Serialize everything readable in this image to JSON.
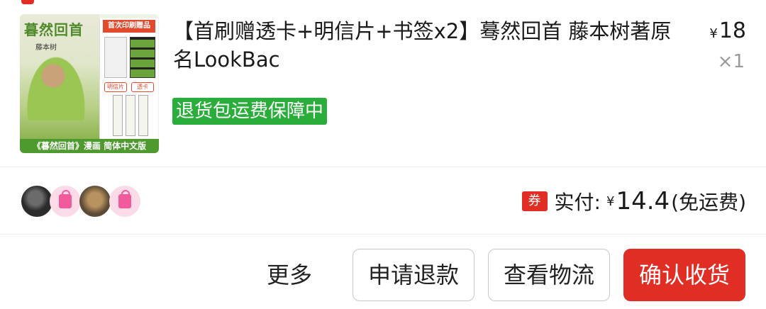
{
  "product": {
    "thumbnail": {
      "cover_title": "暮然回首",
      "cover_author": "藤本树",
      "gift_header": "首次印刷赠品",
      "gift_label_1": "明信片",
      "gift_label_2": "透卡",
      "bottom_caption": "《暮然回首》漫画 简体中文版"
    },
    "title": "【首刷赠透卡+明信片+书签x2】蓦然回首 藤本树著原名LookBac",
    "price_currency": "¥",
    "price": "18",
    "quantity": "×1",
    "guarantee_badge": "退货包运费保障中"
  },
  "payment": {
    "coupon_icon_text": "券",
    "label": "实付:",
    "currency": "¥",
    "amount": "14.4",
    "shipping_note": "(免运费)"
  },
  "actions": {
    "more_label": "更多",
    "refund_label": "申请退款",
    "track_label": "查看物流",
    "confirm_label": "确认收货"
  },
  "colors": {
    "accent_red": "#e02e24",
    "guarantee_green": "#2aad3b",
    "avatar_pink_bg": "#fbdbe8",
    "bag_pink": "#f15a9b"
  },
  "icons": [
    "coupon-icon",
    "shopping-bag-icon"
  ]
}
